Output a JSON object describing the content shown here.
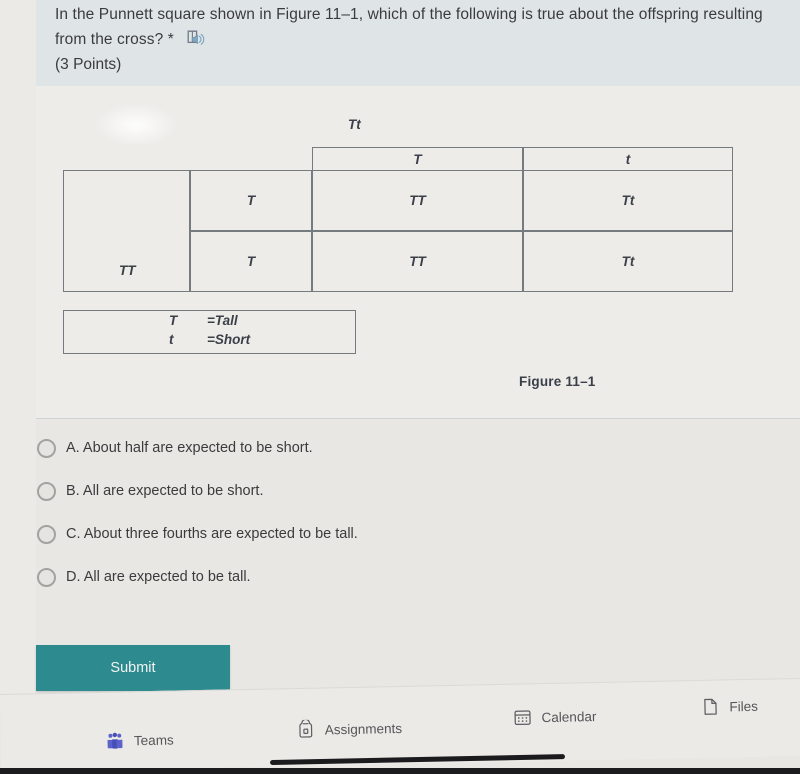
{
  "question": {
    "text": "In the Punnett square shown in Figure 11–1, which of the following is true about the offspring resulting from the cross?",
    "required_marker": "*",
    "points": "(3 Points)",
    "read_aloud_icon": "immersive-reader-icon"
  },
  "figure": {
    "caption": "Figure 11–1",
    "top_parent_genotype": "Tt",
    "left_parent_genotype": "TT",
    "column_headers": [
      "T",
      "t"
    ],
    "row_headers": [
      "T",
      "T"
    ],
    "offspring": [
      [
        "TT",
        "Tt"
      ],
      [
        "TT",
        "Tt"
      ]
    ],
    "legend": [
      {
        "symbol": "T",
        "meaning": "=Tall"
      },
      {
        "symbol": "t",
        "meaning": "=Short"
      }
    ]
  },
  "options": [
    {
      "label": "A. About half are expected to be short.",
      "selected": false
    },
    {
      "label": "B. All are expected to be short.",
      "selected": false
    },
    {
      "label": "C. About three fourths are expected to be tall.",
      "selected": false
    },
    {
      "label": "D. All are expected to be tall.",
      "selected": false
    }
  ],
  "submit": {
    "label": "Submit",
    "color": "#2d8a8e"
  },
  "bottom_nav": [
    {
      "label": "Teams",
      "icon": "teams-icon",
      "color": "#5059c9"
    },
    {
      "label": "Assignments",
      "icon": "assignments-icon",
      "color": "#55565a"
    },
    {
      "label": "Calendar",
      "icon": "calendar-icon",
      "color": "#55565a"
    },
    {
      "label": "Files",
      "icon": "files-icon",
      "color": "#55565a"
    }
  ]
}
